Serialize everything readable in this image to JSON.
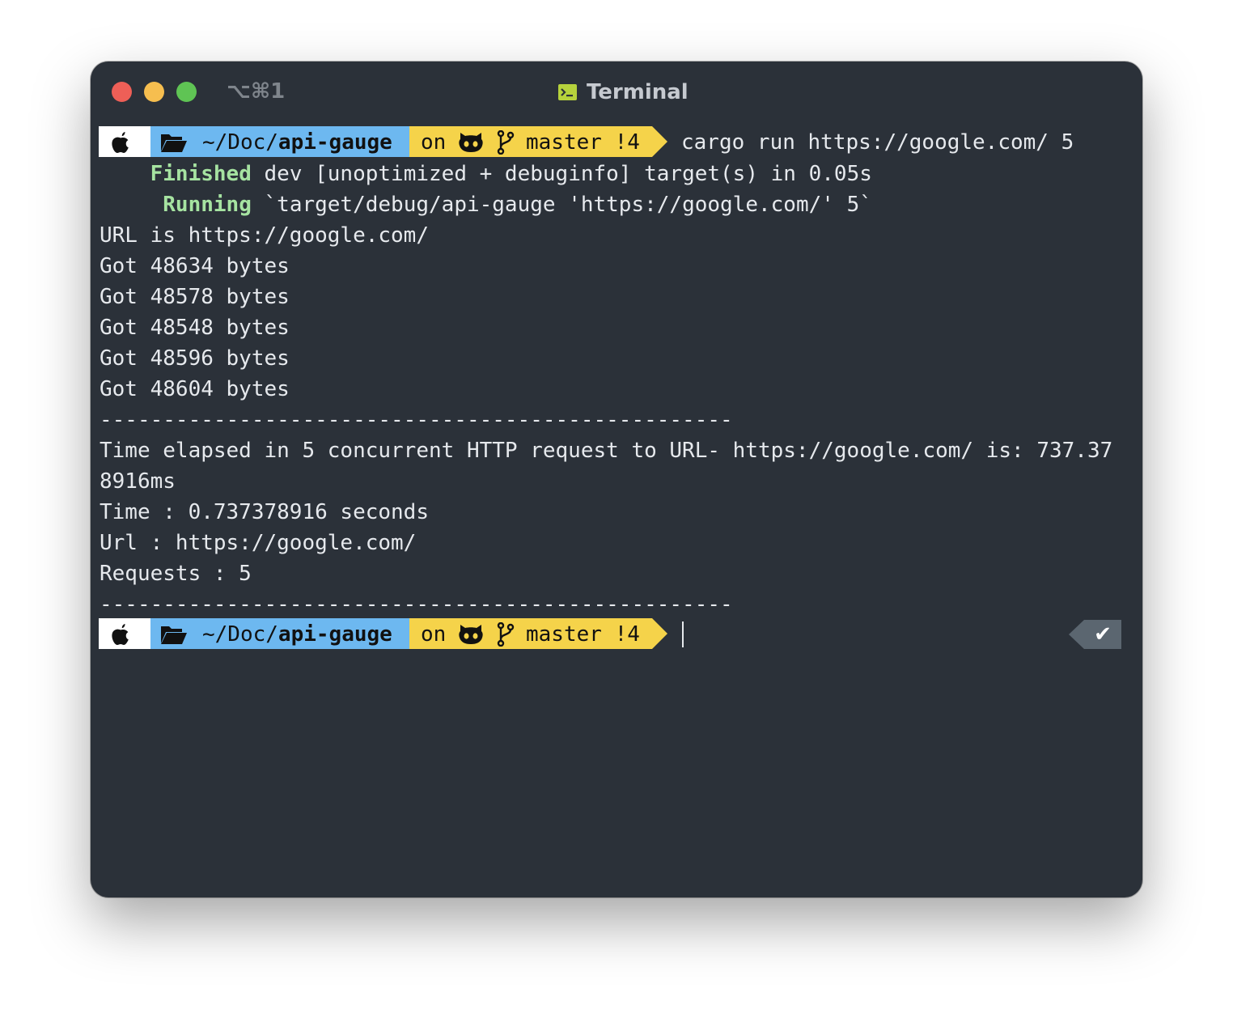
{
  "window": {
    "shortcut": "⌥⌘1",
    "title": "Terminal"
  },
  "prompt": {
    "dir_prefix": "~/Doc/",
    "dir_name": "api-gauge",
    "git_on": "on",
    "git_branch": "master !4"
  },
  "session": {
    "command": "cargo run https://google.com/ 5",
    "finished_label": "Finished",
    "finished_rest": " dev [unoptimized + debuginfo] target(s) in 0.05s",
    "running_label": "Running",
    "running_rest": " `target/debug/api-gauge 'https://google.com/' 5`",
    "output": [
      "URL is https://google.com/",
      "Got 48634 bytes",
      "Got 48578 bytes",
      "Got 48548 bytes",
      "Got 48596 bytes",
      "Got 48604 bytes",
      "--------------------------------------------------",
      "Time elapsed in 5 concurrent HTTP request to URL- https://google.com/ is: 737.37",
      "8916ms",
      "Time : 0.737378916 seconds",
      "Url : https://google.com/",
      "Requests : 5",
      "--------------------------------------------------"
    ]
  },
  "status": {
    "check": "✔"
  }
}
